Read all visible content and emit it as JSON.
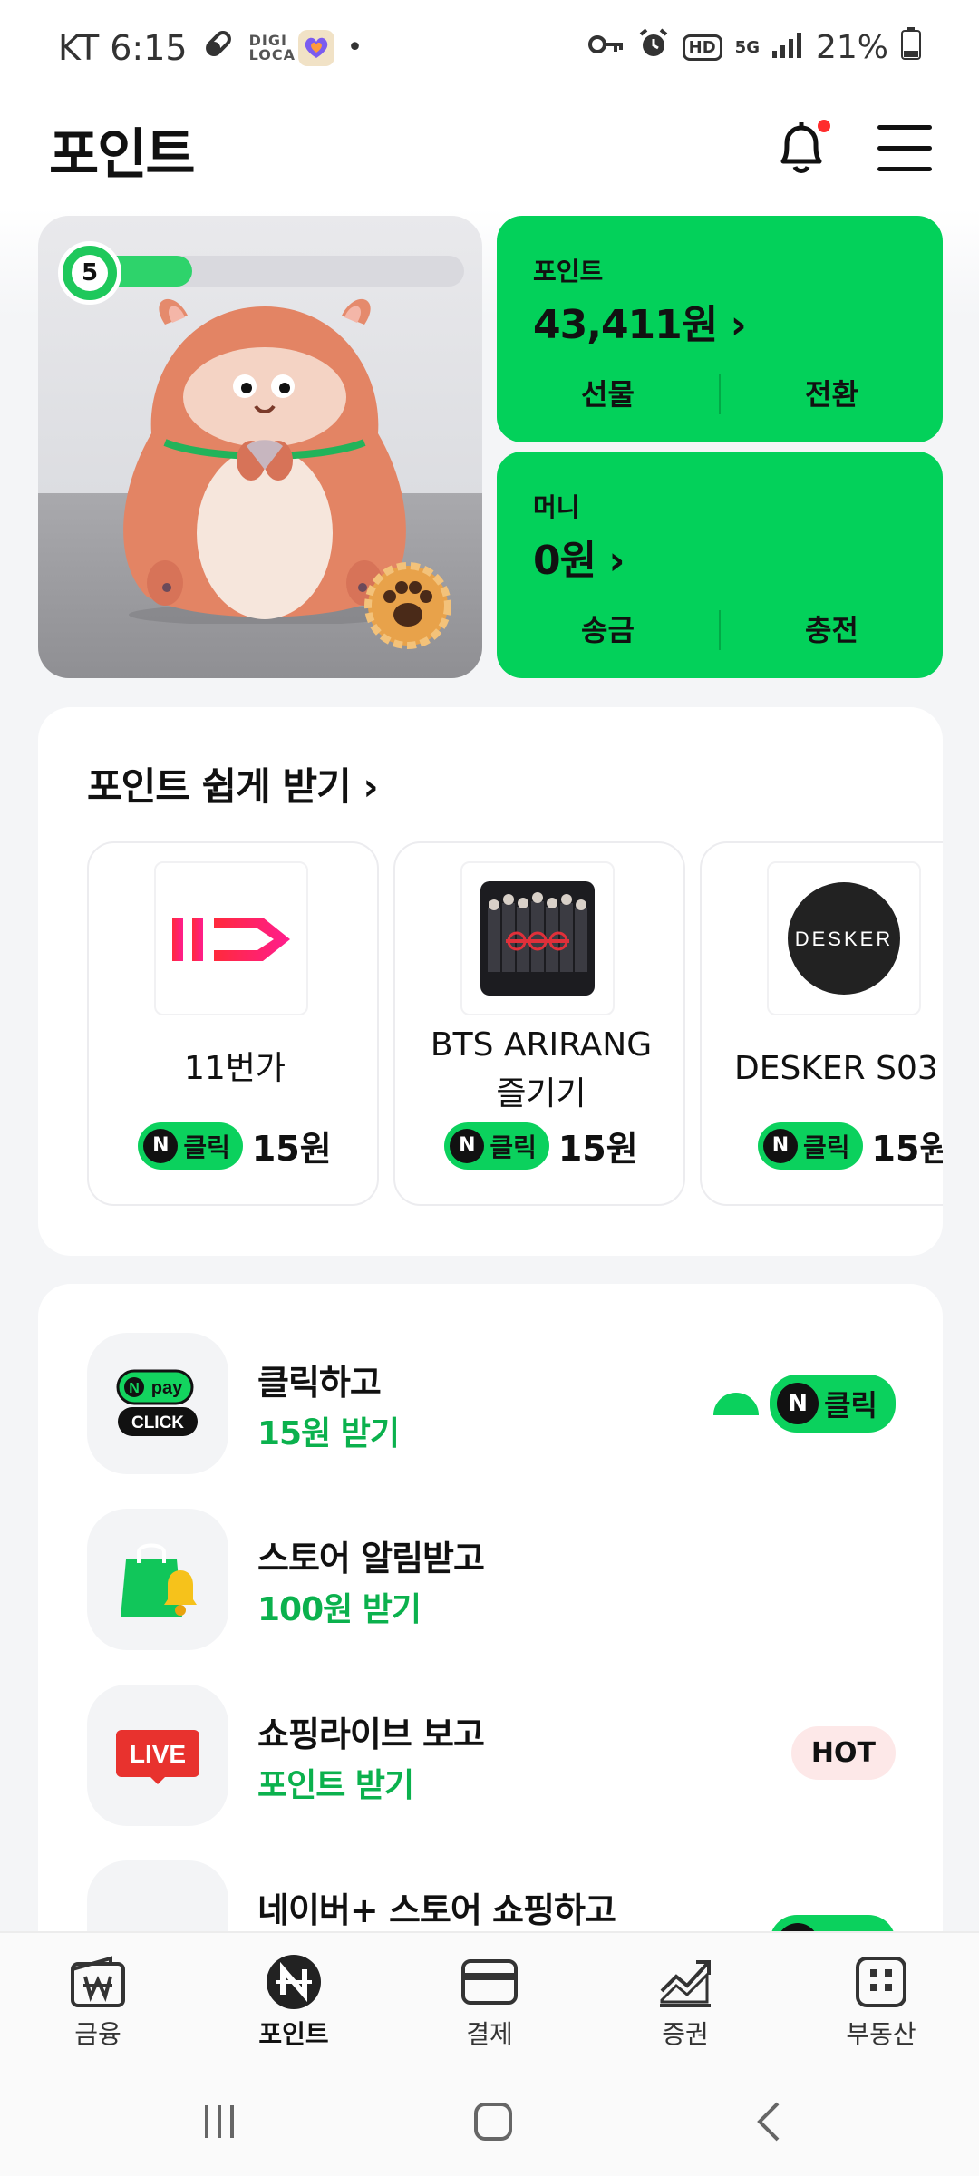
{
  "status_bar": {
    "carrier_time": "KT 6:15",
    "app_label": "DIGI LOCA",
    "dot": "•",
    "hd_label": "HD",
    "network_label": "5G",
    "battery": "21%"
  },
  "header": {
    "title": "포인트"
  },
  "hamster_card": {
    "level": "5",
    "level_progress": 0.25
  },
  "point_card": {
    "label": "포인트",
    "amount": "43,411원 ›",
    "btn_left": "선물",
    "btn_right": "전환"
  },
  "money_card": {
    "label": "머니",
    "amount": "0원 ›",
    "btn_left": "송금",
    "btn_right": "충전"
  },
  "easy_points": {
    "title": "포인트 쉽게 받기 ›",
    "products": [
      {
        "name": "11번가",
        "badge": "클릭",
        "badge_icon": "N",
        "reward": "15원"
      },
      {
        "name_line1": "BTS ARIRANG",
        "name_line2": "즐기기",
        "badge": "클릭",
        "badge_icon": "N",
        "reward": "15원"
      },
      {
        "name": "DESKER S03",
        "logo_text": "DESKER",
        "badge": "클릭",
        "badge_icon": "N",
        "reward": "15원"
      }
    ]
  },
  "list": {
    "rows": [
      {
        "title": "클릭하고",
        "sub": "15원 받기",
        "icon_text_top": "pay",
        "icon_text_bottom": "CLICK",
        "badge": "클릭",
        "badge_icon": "N"
      },
      {
        "title": "스토어 알림받고",
        "sub": "100원 받기"
      },
      {
        "title": "쇼핑라이브 보고",
        "sub": "포인트 받기",
        "icon_text": "LIVE",
        "hot": "HOT"
      },
      {
        "title": "네이버+ 스토어 쇼핑하고",
        "badge": "클릭",
        "badge_icon": "N"
      }
    ]
  },
  "bottom_nav": {
    "items": [
      {
        "label": "금융"
      },
      {
        "label": "포인트"
      },
      {
        "label": "결제"
      },
      {
        "label": "증권"
      },
      {
        "label": "부동산"
      }
    ]
  },
  "colors": {
    "brand_green": "#03d15a",
    "reward_green": "#0bb14d",
    "notification_red": "#ff2d2d"
  }
}
